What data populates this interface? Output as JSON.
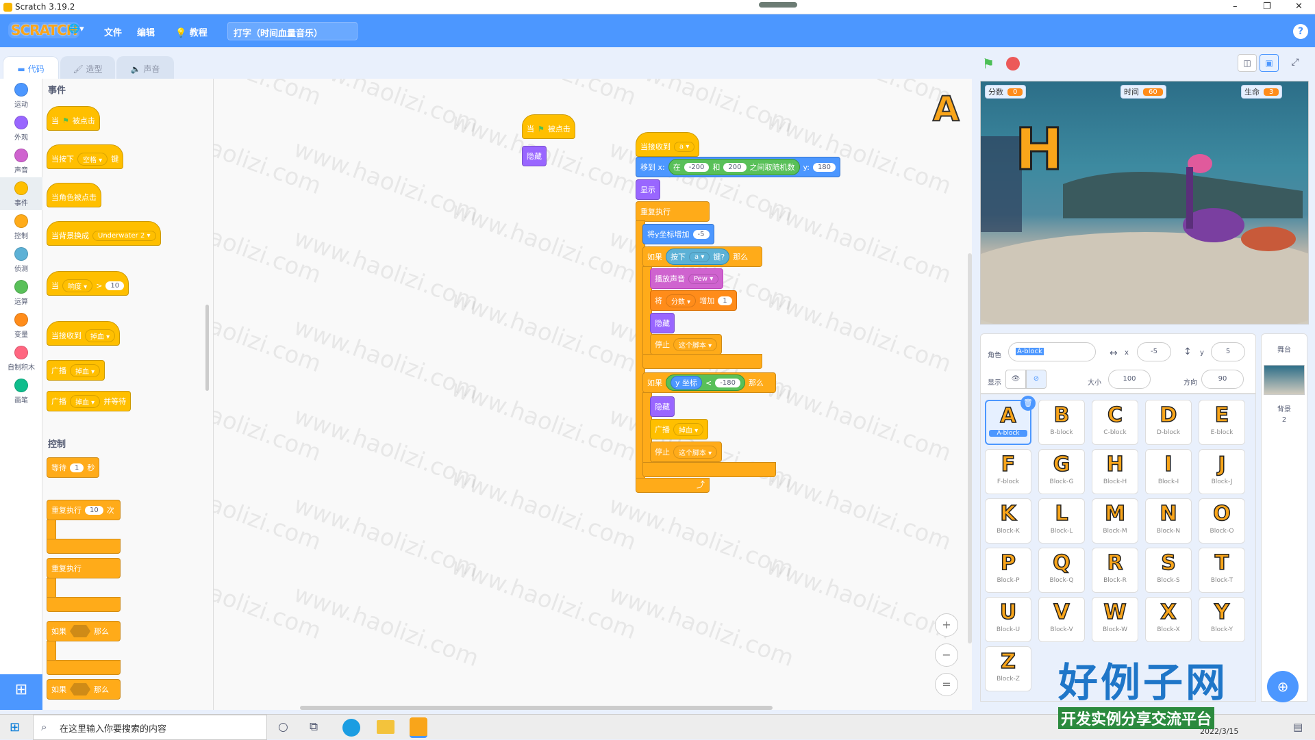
{
  "window": {
    "title": "Scratch 3.19.2",
    "minimize": "–",
    "maximize": "❐",
    "close": "✕"
  },
  "menubar": {
    "logo": "SCRATCH",
    "globe": "🌐▾",
    "file": "文件",
    "edit": "编辑",
    "tutorial": "教程",
    "project_title": "打字（时间血量音乐）",
    "help": "?"
  },
  "tabs": {
    "code": "代码",
    "costumes": "造型",
    "sounds": "声音"
  },
  "categories": [
    "运动",
    "外观",
    "声音",
    "事件",
    "控制",
    "侦测",
    "运算",
    "变量",
    "自制积木",
    "画笔"
  ],
  "category_colors": [
    "#4c97ff",
    "#9966ff",
    "#cf63cf",
    "#ffbf00",
    "#ffab19",
    "#5cb1d6",
    "#59c059",
    "#ff8c1a",
    "#ff6680",
    "#0fbd8c"
  ],
  "palette": {
    "events_title": "事件",
    "flag_clicked": [
      "当",
      "被点击"
    ],
    "key_pressed": [
      "当按下",
      "空格",
      "键"
    ],
    "sprite_clicked": "当角色被点击",
    "backdrop_switch": [
      "当背景换成",
      "Underwater 2"
    ],
    "greater": [
      "当",
      "响度",
      ">",
      "10"
    ],
    "receive": [
      "当接收到",
      "掉血"
    ],
    "broadcast": [
      "广播",
      "掉血"
    ],
    "broadcast_wait": [
      "广播",
      "掉血",
      "并等待"
    ],
    "control_title": "控制",
    "wait": [
      "等待",
      "1",
      "秒"
    ],
    "repeat": [
      "重复执行",
      "10",
      "次"
    ],
    "forever": "重复执行",
    "if1": [
      "如果",
      "那么"
    ],
    "if2": [
      "如果",
      "那么"
    ]
  },
  "scripts": {
    "s1": {
      "hat": [
        "当",
        "被点击"
      ],
      "hide": "隐藏"
    },
    "s2": {
      "hat": [
        "当接收到",
        "a"
      ],
      "goto": [
        "移到 x:",
        "在",
        "-200",
        "和",
        "200",
        "之间取随机数",
        "y:",
        "180"
      ],
      "show": "显示",
      "forever": "重复执行",
      "change_y": [
        "将y坐标增加",
        "-5"
      ],
      "if_key": [
        "如果",
        "按下",
        "a",
        "键?",
        "那么"
      ],
      "play": [
        "播放声音",
        "Pew"
      ],
      "change_var": [
        "将",
        "分数",
        "增加",
        "1"
      ],
      "hide": "隐藏",
      "stop": [
        "停止",
        "这个脚本"
      ],
      "if_y": [
        "如果",
        "y 坐标",
        "<",
        "-180",
        "那么"
      ],
      "hide2": "隐藏",
      "broadcast": [
        "广播",
        "掉血"
      ],
      "stop2": [
        "停止",
        "这个脚本"
      ]
    }
  },
  "code_sprite_letter": "A",
  "zoom": {
    "in": "+",
    "out": "−",
    "reset": "="
  },
  "stage": {
    "monitors": [
      {
        "label": "分数",
        "value": "0"
      },
      {
        "label": "时间",
        "value": "60"
      },
      {
        "label": "生命",
        "value": "3"
      }
    ],
    "letter": "H"
  },
  "sprite_info": {
    "sprite_label": "角色",
    "sprite_name": "A-block",
    "x_label": "x",
    "x": "-5",
    "y_label": "y",
    "y": "5",
    "show_label": "显示",
    "size_label": "大小",
    "size": "100",
    "dir_label": "方向",
    "dir": "90"
  },
  "sprites": [
    {
      "g": "A",
      "n": "A-block"
    },
    {
      "g": "B",
      "n": "B-block"
    },
    {
      "g": "C",
      "n": "C-block"
    },
    {
      "g": "D",
      "n": "D-block"
    },
    {
      "g": "E",
      "n": "E-block"
    },
    {
      "g": "F",
      "n": "F-block"
    },
    {
      "g": "G",
      "n": "Block-G"
    },
    {
      "g": "H",
      "n": "Block-H"
    },
    {
      "g": "I",
      "n": "Block-I"
    },
    {
      "g": "J",
      "n": "Block-J"
    },
    {
      "g": "K",
      "n": "Block-K"
    },
    {
      "g": "L",
      "n": "Block-L"
    },
    {
      "g": "M",
      "n": "Block-M"
    },
    {
      "g": "N",
      "n": "Block-N"
    },
    {
      "g": "O",
      "n": "Block-O"
    },
    {
      "g": "P",
      "n": "Block-P"
    },
    {
      "g": "Q",
      "n": "Block-Q"
    },
    {
      "g": "R",
      "n": "Block-R"
    },
    {
      "g": "S",
      "n": "Block-S"
    },
    {
      "g": "T",
      "n": "Block-T"
    },
    {
      "g": "U",
      "n": "Block-U"
    },
    {
      "g": "V",
      "n": "Block-V"
    },
    {
      "g": "W",
      "n": "Block-W"
    },
    {
      "g": "X",
      "n": "Block-X"
    },
    {
      "g": "Y",
      "n": "Block-Y"
    },
    {
      "g": "Z",
      "n": "Block-Z"
    }
  ],
  "stage_panel": {
    "title": "舞台",
    "backdrops_label": "背景",
    "backdrops_count": "2"
  },
  "taskbar": {
    "search_placeholder": "在这里输入你要搜索的内容",
    "date": "2022/3/15"
  },
  "watermark": "www.haolizi.com",
  "brand": {
    "main": "好例子网",
    "sub": "开发实例分享交流平台"
  }
}
